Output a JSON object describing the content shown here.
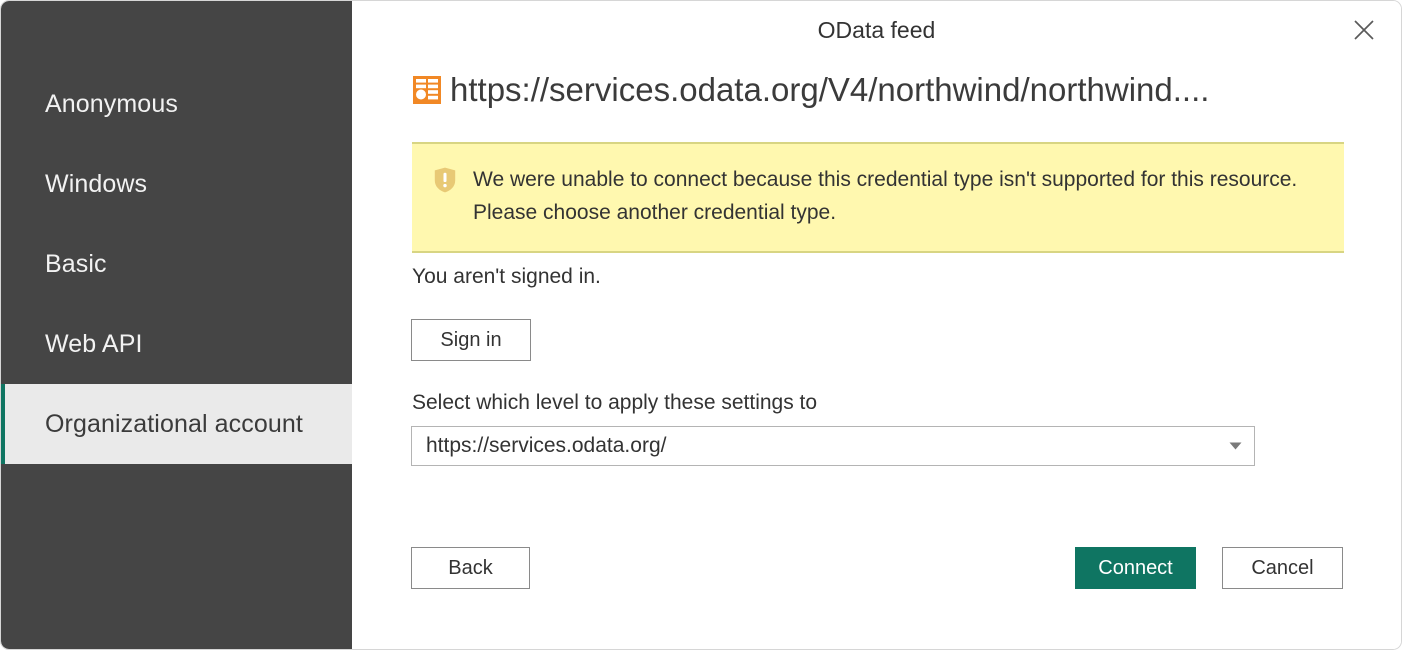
{
  "window": {
    "title": "OData feed",
    "close_icon": "close-icon"
  },
  "sidebar": {
    "items": [
      {
        "label": "Anonymous",
        "selected": false
      },
      {
        "label": "Windows",
        "selected": false
      },
      {
        "label": "Basic",
        "selected": false
      },
      {
        "label": "Web API",
        "selected": false
      },
      {
        "label": "Organizational account",
        "selected": true
      }
    ],
    "background_color": "#454545",
    "selected_background_color": "#eaeaea",
    "selection_accent_color": "#0f7562"
  },
  "source": {
    "icon": "odata-table-icon",
    "icon_color": "#f18825",
    "url": "https://services.odata.org/V4/northwind/northwind...."
  },
  "warning": {
    "icon": "warning-shield-icon",
    "message": "We were unable to connect because this credential type isn't supported for this resource. Please choose another credential type.",
    "background_color": "#fff8af",
    "border_color": "#d8d583"
  },
  "signin": {
    "status": "You aren't signed in.",
    "button_label": "Sign in"
  },
  "level": {
    "label": "Select which level to apply these settings to",
    "selected_value": "https://services.odata.org/",
    "dropdown_icon": "chevron-down-icon"
  },
  "footer": {
    "back_label": "Back",
    "connect_label": "Connect",
    "cancel_label": "Cancel",
    "connect_color": "#0f7562"
  }
}
